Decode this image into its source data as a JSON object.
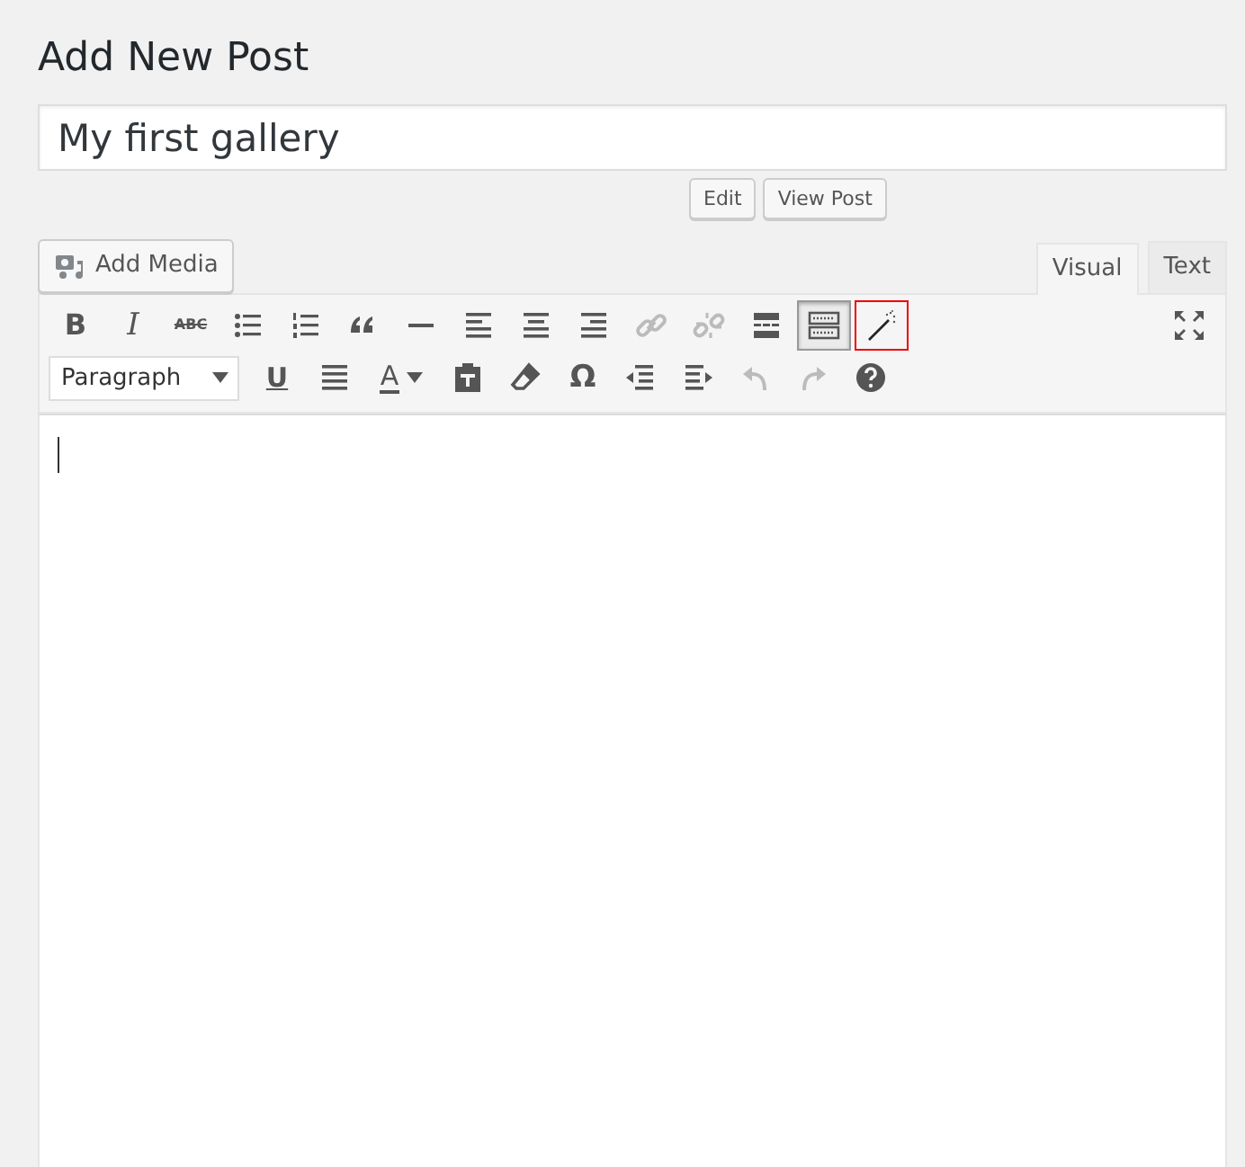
{
  "page_title": "Add New Post",
  "post_title": {
    "value": "My first gallery"
  },
  "permalink_buttons": [
    "Edit",
    "View Post"
  ],
  "add_media": {
    "label": "Add Media"
  },
  "editor_tabs": [
    {
      "label": "Visual",
      "selected": true
    },
    {
      "label": "Text",
      "selected": false
    }
  ],
  "toolbar_rows": [
    [
      {
        "kind": "bold",
        "label": "B",
        "disabled": false,
        "active": false,
        "highlighted": false
      },
      {
        "kind": "italic",
        "label": "I",
        "disabled": false,
        "active": false,
        "highlighted": false
      },
      {
        "kind": "strike",
        "label": "ABC",
        "disabled": false,
        "active": false,
        "highlighted": false
      },
      {
        "kind": "bullet-list",
        "disabled": false,
        "active": false,
        "highlighted": false
      },
      {
        "kind": "numbered-list",
        "disabled": false,
        "active": false,
        "highlighted": false
      },
      {
        "kind": "quote",
        "disabled": false,
        "active": false,
        "highlighted": false
      },
      {
        "kind": "rule",
        "disabled": false,
        "active": false,
        "highlighted": false
      },
      {
        "kind": "align-left",
        "disabled": false,
        "active": false,
        "highlighted": false
      },
      {
        "kind": "align-center",
        "disabled": false,
        "active": false,
        "highlighted": false
      },
      {
        "kind": "align-right",
        "disabled": false,
        "active": false,
        "highlighted": false
      },
      {
        "kind": "link",
        "disabled": true,
        "active": false,
        "highlighted": false
      },
      {
        "kind": "unlink",
        "disabled": true,
        "active": false,
        "highlighted": false
      },
      {
        "kind": "more",
        "disabled": false,
        "active": false,
        "highlighted": false
      },
      {
        "kind": "toolbar",
        "disabled": false,
        "active": true,
        "highlighted": false
      },
      {
        "kind": "wand",
        "disabled": false,
        "active": false,
        "highlighted": true
      },
      {
        "kind": "fullscreen",
        "disabled": false,
        "active": false,
        "highlighted": false
      }
    ],
    [
      {
        "kind": "format",
        "label": "Paragraph"
      },
      {
        "kind": "underline",
        "label": "U",
        "disabled": false,
        "active": false,
        "highlighted": false
      },
      {
        "kind": "justify",
        "disabled": false,
        "active": false,
        "highlighted": false
      },
      {
        "kind": "text-color",
        "label": "A",
        "disabled": false,
        "active": false,
        "highlighted": false
      },
      {
        "kind": "paste-text",
        "disabled": false,
        "active": false,
        "highlighted": false
      },
      {
        "kind": "eraser",
        "disabled": false,
        "active": false,
        "highlighted": false
      },
      {
        "kind": "charmap",
        "label": "Ω",
        "disabled": false,
        "active": false,
        "highlighted": false
      },
      {
        "kind": "outdent",
        "disabled": false,
        "active": false,
        "highlighted": false
      },
      {
        "kind": "indent",
        "disabled": false,
        "active": false,
        "highlighted": false
      },
      {
        "kind": "undo",
        "disabled": true,
        "active": false,
        "highlighted": false
      },
      {
        "kind": "redo",
        "disabled": true,
        "active": false,
        "highlighted": false
      },
      {
        "kind": "help",
        "disabled": false,
        "active": false,
        "highlighted": false
      }
    ]
  ]
}
